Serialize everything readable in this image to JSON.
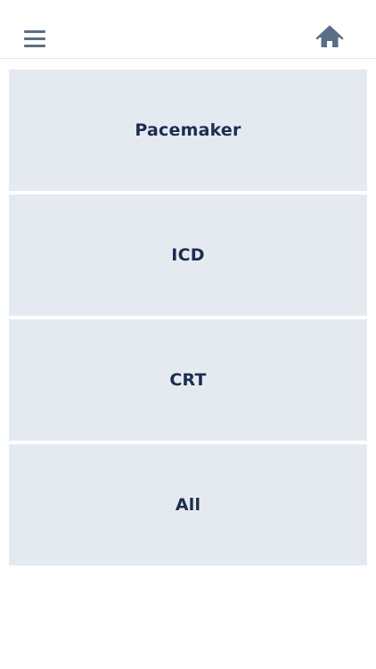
{
  "header": {
    "menu_icon": "hamburger-menu-icon",
    "home_icon": "home-icon",
    "icon_color": "#5a6f85"
  },
  "tiles": [
    {
      "label": "Pacemaker"
    },
    {
      "label": "ICD"
    },
    {
      "label": "CRT"
    },
    {
      "label": "All"
    }
  ],
  "colors": {
    "tile_background": "#e5eaf0",
    "tile_text": "#1c2d4f",
    "page_background": "#ffffff"
  }
}
